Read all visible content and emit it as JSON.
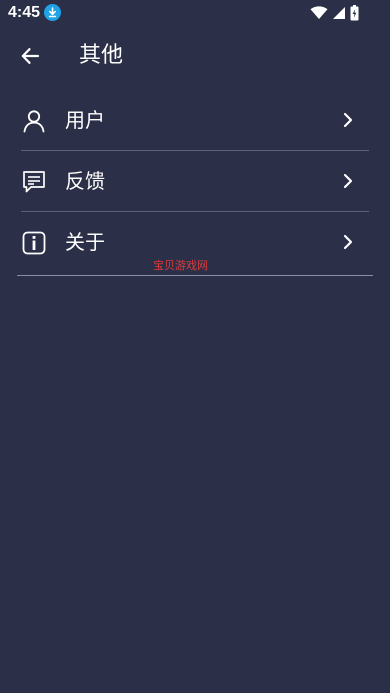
{
  "status_bar": {
    "time": "4:45",
    "icons": [
      "download-icon",
      "wifi-icon",
      "signal-icon",
      "battery-icon"
    ]
  },
  "app_bar": {
    "title": "其他",
    "back_icon": "arrow-left-icon"
  },
  "menu": {
    "items": [
      {
        "label": "用户",
        "icon": "user-icon"
      },
      {
        "label": "反馈",
        "icon": "feedback-icon"
      },
      {
        "label": "关于",
        "icon": "info-icon"
      }
    ]
  },
  "watermark": "宝贝游戏网",
  "colors": {
    "background": "#2b2f47",
    "divider": "#5d6177",
    "text": "#ffffff",
    "watermark": "#e03a3a",
    "download_badge": "#1fa3e6"
  }
}
